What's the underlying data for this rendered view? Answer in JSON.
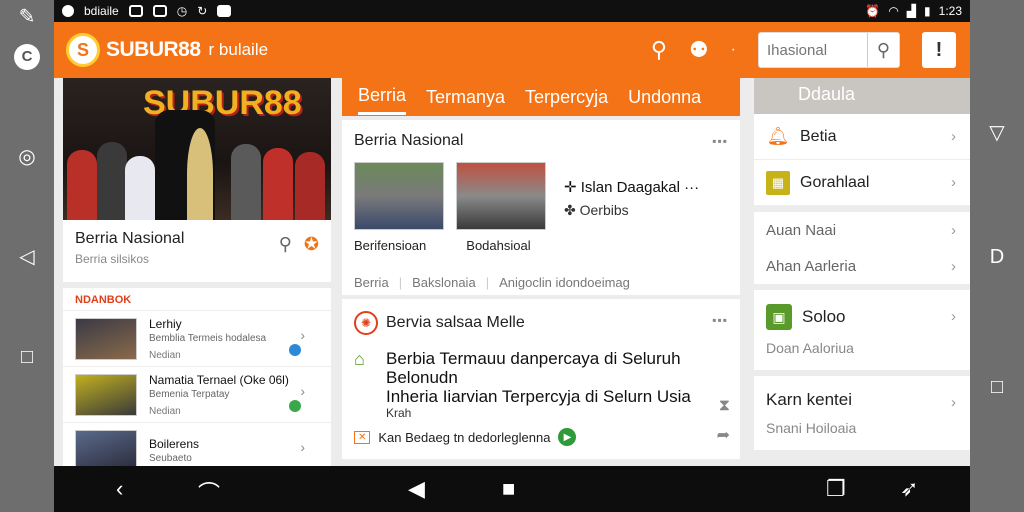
{
  "status_bar": {
    "app_label": "bdiaile",
    "time": "1:23"
  },
  "app_bar": {
    "brand": "SUBUR88",
    "brand_sub": "r bulaile",
    "search_placeholder": "Ihasional",
    "more_label": "!"
  },
  "hero": {
    "banner_text": "SUBUR88",
    "title": "Berria Nasional",
    "subtitle": "Berria silsikos"
  },
  "left_list": {
    "header": "NDANBOK",
    "items": [
      {
        "title": "Lerhiy",
        "subtitle": "Bemblia Termeis hodalesa",
        "meta": "Nedian",
        "badge_color": "#2a8ad8"
      },
      {
        "title": "Namatia Ternael (Oke 06l)",
        "subtitle": "Bemenia Terpatay",
        "meta": "Nedian",
        "badge_color": "#3aa84a"
      },
      {
        "title": "Boilerens",
        "subtitle": "Seubaeto",
        "meta": "",
        "badge_color": ""
      }
    ]
  },
  "tabs": [
    "Berria",
    "Termanya",
    "Terpercyja",
    "Undonna"
  ],
  "card1": {
    "title": "Berria Nasional",
    "side_title": "Islan Daagakal",
    "side_sub": "Oerbibs",
    "captions": [
      "Berifensioan",
      "Bodahsioal"
    ],
    "tags": [
      "Berria",
      "Bakslonaia",
      "Anigoclin idondoeimag"
    ]
  },
  "card2": {
    "title": "Bervia salsaa Melle",
    "headline_1": "Berbia Termauu danpercaya di Seluruh Belonudn",
    "headline_2": "Inheria Iiarvian Terpercyja di Selurn Usia",
    "small": "Krah",
    "footer": "Kan Bedaeg tn dedorleglenna"
  },
  "right_panel": {
    "header": "Ddaula",
    "items": [
      {
        "label": "Betia",
        "icon": "bell-icon",
        "color": "#f47316"
      },
      {
        "label": "Gorahlaal",
        "icon": "grid-icon",
        "color": "#c8b21a"
      }
    ],
    "plain_items": [
      "Auan Naai",
      "Ahan Aarleria"
    ],
    "block1": {
      "title": "Soloo",
      "sub": "Doan Aaloriua"
    },
    "block2": {
      "title": "Karn kentei",
      "sub": "Snani Hoiloaia"
    }
  },
  "colors": {
    "accent": "#f47316",
    "status_bar": "#101010",
    "nav_bar": "#0d0d0d"
  }
}
